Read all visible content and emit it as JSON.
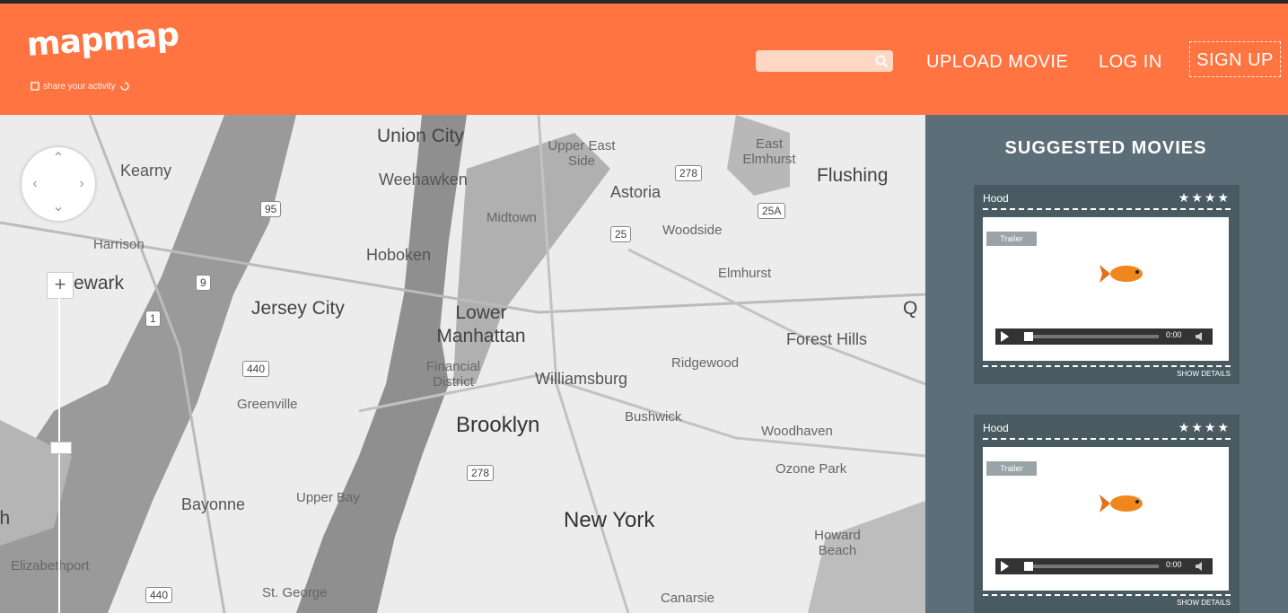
{
  "header": {
    "logo": "mapmap",
    "tagline": "share your activity",
    "search": {
      "value": "",
      "placeholder": ""
    },
    "nav": {
      "upload": "UPLOAD MOVIE",
      "login": "LOG IN",
      "signup": "SIGN UP"
    },
    "colors": {
      "brand": "#ff7441",
      "panel": "#5c6e78"
    }
  },
  "map": {
    "labels": [
      "Union City",
      "Kearny",
      "Weehawken",
      "Upper East Side",
      "Astoria",
      "East Elmhurst",
      "Flushing",
      "Harrison",
      "Midtown",
      "Woodside",
      "Hoboken",
      "ewark",
      "Jersey City",
      "Elmhurst",
      "Lower Manhattan",
      "Financial District",
      "Williamsburg",
      "Ridgewood",
      "Forest Hills",
      "Greenville",
      "Brooklyn",
      "Bushwick",
      "Woodhaven",
      "Ozone Park",
      "Bayonne",
      "Upper Bay",
      "New York",
      "Howard Beach",
      "Elizabethport",
      "eth",
      "St. George",
      "Canarsie",
      "Q"
    ],
    "shields": [
      "278",
      "95",
      "1",
      "9",
      "25",
      "25A",
      "440",
      "278",
      "440"
    ],
    "controls": {
      "zoom_in": "+"
    }
  },
  "panel": {
    "title": "SUGGESTED MOVIES",
    "movies": [
      {
        "author": "Hood",
        "stars": "★★★★",
        "tag": "Trailer",
        "time": "0:00",
        "footer": "SHOW DETAILS"
      },
      {
        "author": "Hood",
        "stars": "★★★★",
        "tag": "Trailer",
        "time": "0:00",
        "footer": "SHOW DETAILS"
      }
    ]
  }
}
